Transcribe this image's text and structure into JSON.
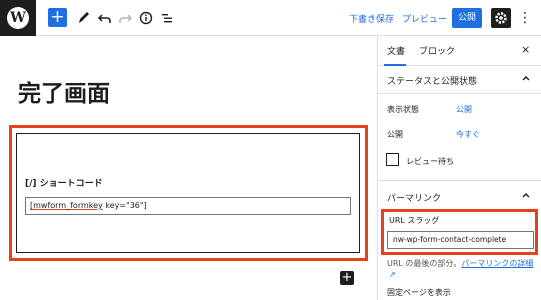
{
  "toolbar": {
    "wp_logo": "W",
    "add_icon": "+",
    "icons": [
      "pencil-icon",
      "undo-icon",
      "redo-icon",
      "info-icon",
      "list-view-icon"
    ],
    "save_draft": "下書き保存",
    "preview": "プレビュー",
    "publish": "公開",
    "more_icon": "⋮"
  },
  "editor": {
    "page_title": "完了画面",
    "shortcode_label": "[/]  ショートコード",
    "shortcode_value_pre": "[mwform_formkey",
    "shortcode_value_post": " key=\"36\"]",
    "add_block_icon": "+"
  },
  "sidebar": {
    "tab_document": "文書",
    "tab_block": "ブロック",
    "close_icon": "×",
    "status_panel": "ステータスと公開状態",
    "visibility_label": "表示状態",
    "visibility_value": "公開",
    "publish_label": "公開",
    "publish_value": "今すぐ",
    "pending_review": "レビュー待ち",
    "permalink_panel": "パーマリンク",
    "url_slug_label": "URL スラッグ",
    "url_slug_value": "nw-wp-form-contact-complete",
    "help_prefix": "URL の最後の部分。",
    "help_link": "パーマリンクの詳細",
    "ext_icon": "↗",
    "fixed_page_link": "固定ページを表示"
  },
  "colors": {
    "accent": "#1f6fe0",
    "highlight": "#e3421f",
    "dark": "#1e1e1e"
  }
}
